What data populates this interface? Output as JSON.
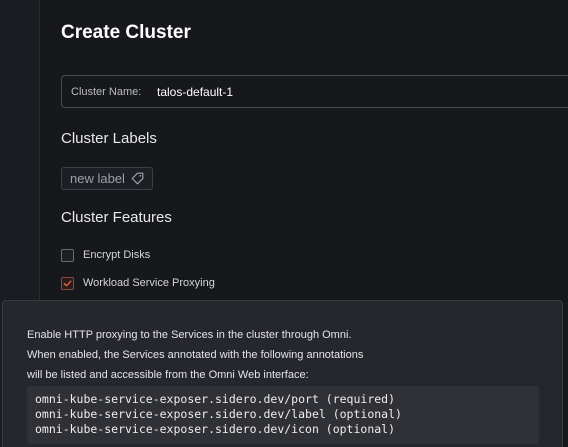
{
  "page": {
    "title": "Create Cluster"
  },
  "cluster_name": {
    "label": "Cluster Name:",
    "value": "talos-default-1"
  },
  "cluster_labels": {
    "title": "Cluster Labels",
    "new_label": "new label"
  },
  "cluster_features": {
    "title": "Cluster Features",
    "items": [
      {
        "label": "Encrypt Disks",
        "checked": false
      },
      {
        "label": "Workload Service Proxying",
        "checked": true
      }
    ]
  },
  "tooltip": {
    "lines": [
      "Enable HTTP proxying to the Services in the cluster through Omni.",
      "When enabled, the Services annotated with the following annotations",
      "will be listed and accessible from the Omni Web interface:"
    ],
    "code": [
      "omni-kube-service-exposer.sidero.dev/port (required)",
      "omni-kube-service-exposer.sidero.dev/label (optional)",
      "omni-kube-service-exposer.sidero.dev/icon (optional)"
    ]
  },
  "colors": {
    "background": "#17181c",
    "checkbox_accent": "#e0674f",
    "tooltip_background": "#26272c"
  },
  "icons": {
    "label_tag": "tag-icon",
    "checkmark": "checkmark-icon"
  }
}
